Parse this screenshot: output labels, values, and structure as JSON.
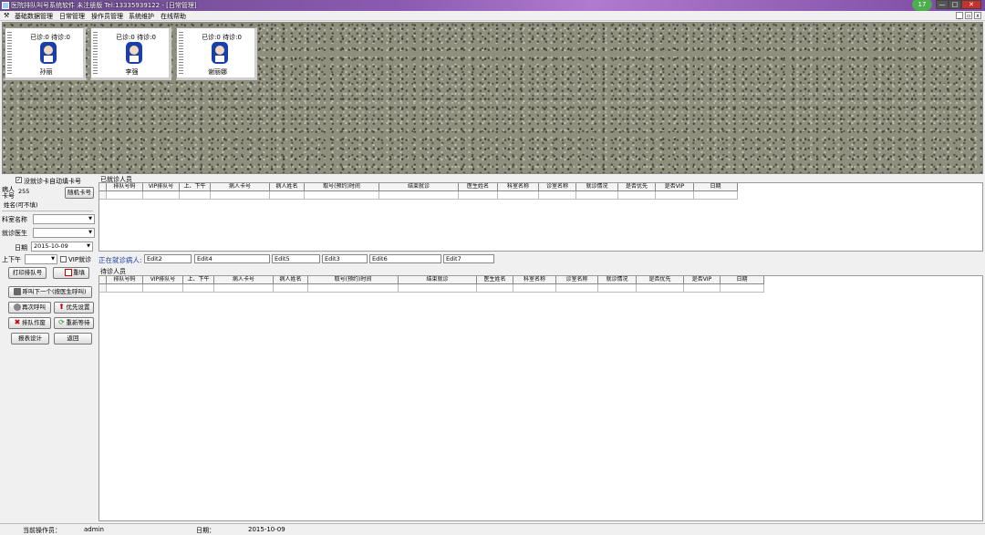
{
  "window": {
    "title": "医院排队叫号系统软件 未注册版 Tel:13335939122 - [日常管理]",
    "controls": [
      "—",
      "□",
      "✕"
    ],
    "badge": "17"
  },
  "menu": [
    "基础数据管理",
    "日常管理",
    "操作员管理",
    "系统维护",
    "在线帮助"
  ],
  "doctor_cards": [
    {
      "stats": "已诊:0  待诊:0",
      "name": "孙丽"
    },
    {
      "stats": "已诊:0  待诊:0",
      "name": "李强"
    },
    {
      "stats": "已诊:0  待诊:0",
      "name": "谢丽娜"
    }
  ],
  "left_panel": {
    "auto_card_label": "没就诊卡自动填卡号",
    "card_no_label": "病人卡号",
    "card_no_value": "255",
    "random_card_button": "随机卡号",
    "patient_name_label": "姓名(可不填)",
    "patient_name_value": "",
    "dept_label": "科室名称",
    "dept_value": "",
    "doctor_label": "就诊医生",
    "doctor_value": "",
    "date_label": "日期",
    "date_value": "2015-10-09",
    "ampm_label": "上下午",
    "ampm_value": "",
    "vip_label": "VIP就诊",
    "print_button": "打印排队号",
    "clear_button": "重填",
    "call_next_button": "呼叫下一个(按医生呼叫)",
    "recall_button": "再次呼叫",
    "priority_button": "优先设置",
    "void_button": "排队作废",
    "requeue_button": "重新等待",
    "report_button": "报表设计",
    "back_button": "返回"
  },
  "done_grid": {
    "title": "已就诊人员",
    "columns": [
      "排队号码",
      "VIP排队号",
      "上、下午",
      "病人卡号",
      "病人姓名",
      "取号(预约)时间",
      "结束就诊",
      "医生姓名",
      "科室名称",
      "诊室名称",
      "就诊情况",
      "是否优先",
      "是否VIP",
      "日期"
    ]
  },
  "current_patient": {
    "label": "正在就诊病人:",
    "edits": [
      "Edit2",
      "Edit4",
      "Edit5",
      "Edit3",
      "Edit6",
      "Edit7"
    ]
  },
  "wait_grid": {
    "title": "待诊人员",
    "columns": [
      "排队号码",
      "VIP排队号",
      "上、下午",
      "病人卡号",
      "病人姓名",
      "取号(预约)时间",
      "结束就诊",
      "医生姓名",
      "科室名称",
      "诊室名称",
      "就诊情况",
      "是否优先",
      "是否VIP",
      "日期"
    ]
  },
  "status": {
    "operator_label": "当前操作员：",
    "operator_value": "admin",
    "date_label": "日期：",
    "date_value": "2015-10-09"
  },
  "colors": {
    "accent_red": "#cc0000",
    "accent_green": "#2a8a2a",
    "doctor_blue": "#1a3fa8"
  }
}
